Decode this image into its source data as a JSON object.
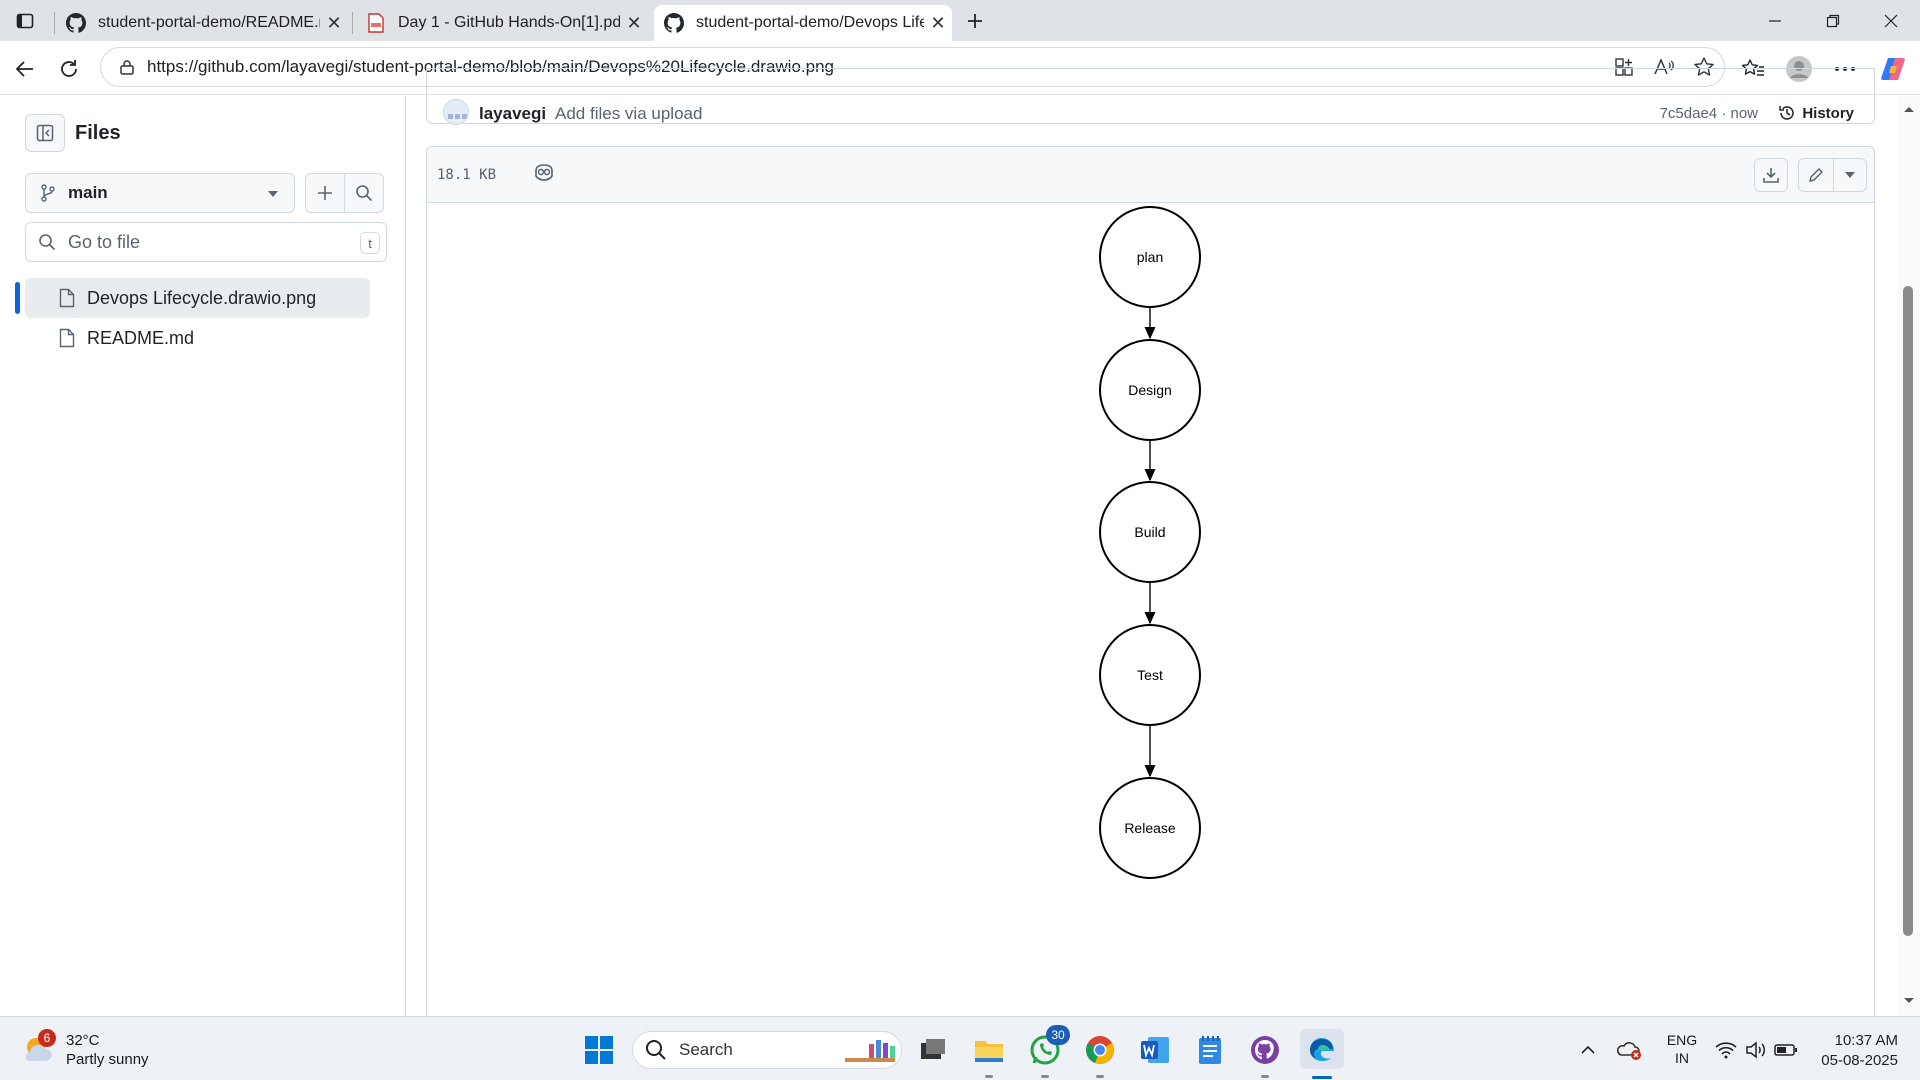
{
  "browser": {
    "tabs": [
      {
        "title": "student-portal-demo/README.md",
        "icon": "github-icon"
      },
      {
        "title": "Day 1 - GitHub Hands-On[1].pdf",
        "icon": "pdf-icon"
      },
      {
        "title": "student-portal-demo/Devops Lifecycle.drawio.png",
        "icon": "github-icon",
        "active": true
      }
    ],
    "url": "https://github.com/layavegi/student-portal-demo/blob/main/Devops%20Lifecycle.drawio.png"
  },
  "sidebar": {
    "title": "Files",
    "branch": "main",
    "goto_placeholder": "Go to file",
    "goto_shortcut": "t",
    "files": [
      {
        "name": "Devops Lifecycle.drawio.png",
        "selected": true
      },
      {
        "name": "README.md",
        "selected": false
      }
    ]
  },
  "commit": {
    "author": "layavegi",
    "message": "Add files via upload",
    "sha_time": "7c5dae4 · now",
    "history_label": "History"
  },
  "file": {
    "size": "18.1 KB"
  },
  "diagram": {
    "nodes": [
      "plan",
      "Design",
      "Build",
      "Test",
      "Release"
    ]
  },
  "taskbar": {
    "weather_badge": "6",
    "temperature": "32°C",
    "condition": "Partly sunny",
    "search_label": "Search",
    "whatsapp_badge": "30",
    "lang_line1": "ENG",
    "lang_line2": "IN",
    "time": "10:37 AM",
    "date": "05-08-2025"
  },
  "colors": {
    "accent": "#0969da",
    "windows_blue": "#0078d4"
  }
}
